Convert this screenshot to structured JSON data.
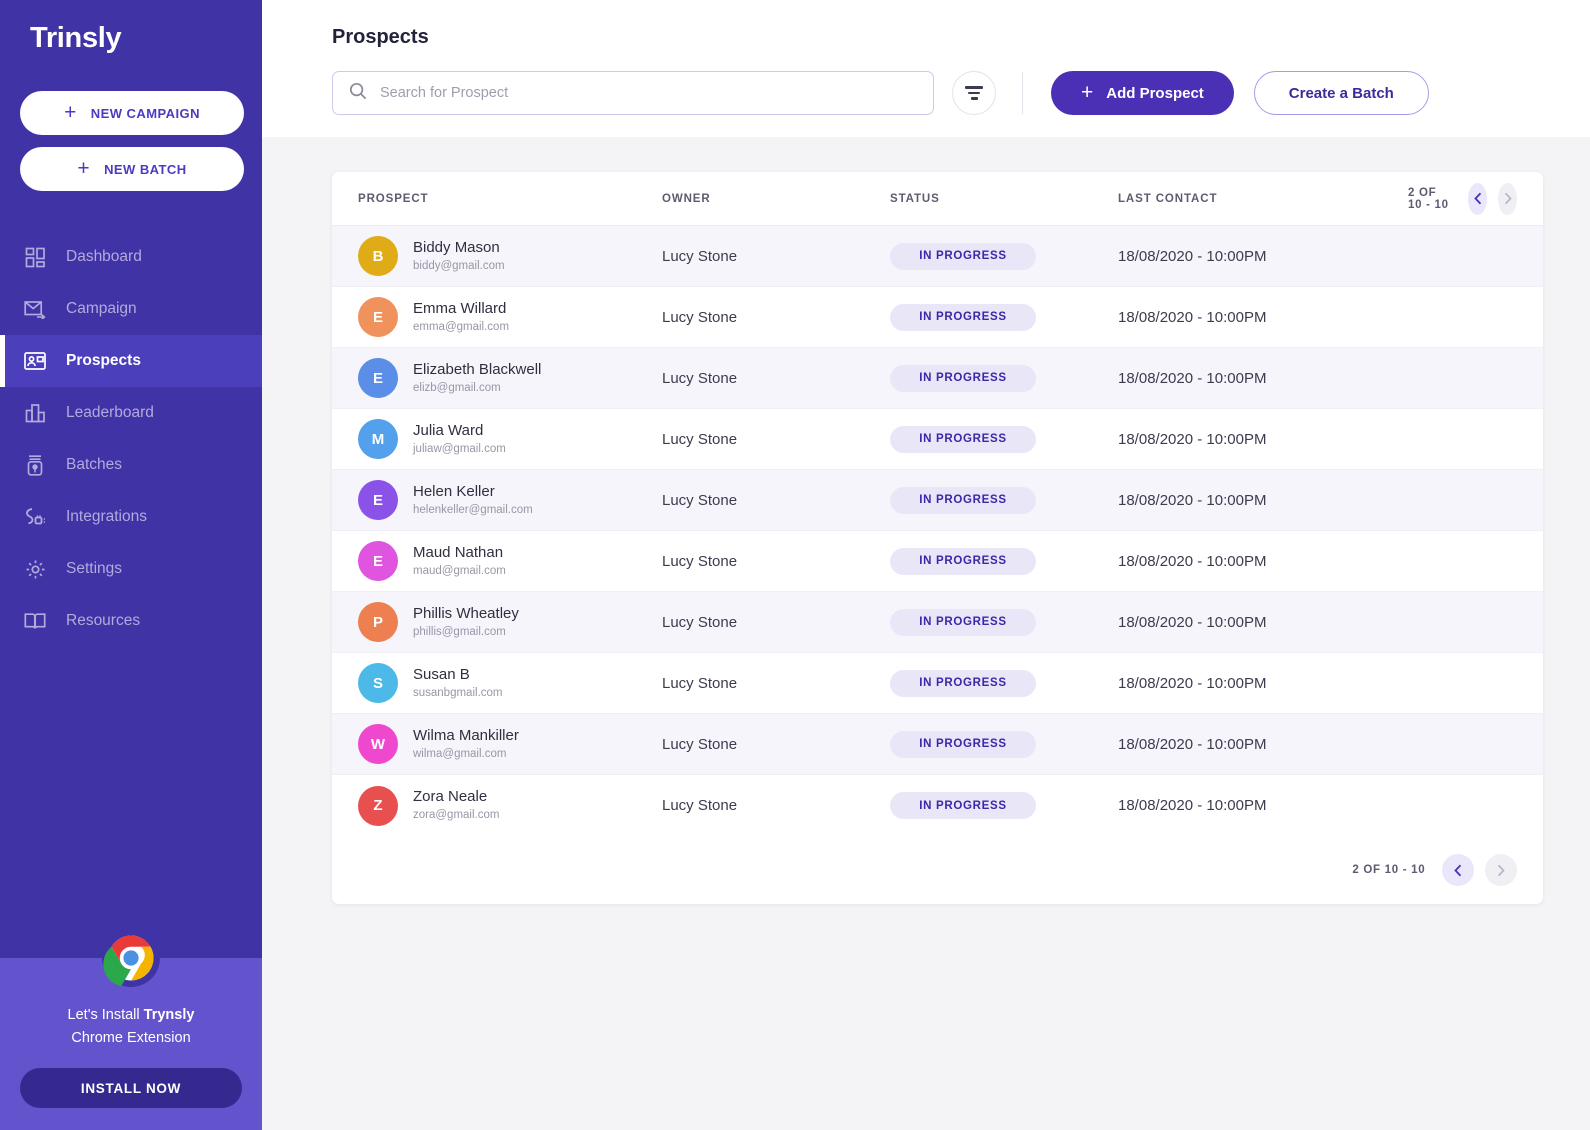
{
  "brand": {
    "logo": "Trinsly"
  },
  "sidebar": {
    "actions": [
      {
        "label": "NEW CAMPAIGN",
        "icon": "plus-icon"
      },
      {
        "label": "NEW BATCH",
        "icon": "plus-icon"
      }
    ],
    "items": [
      {
        "label": "Dashboard",
        "icon": "dashboard-icon",
        "active": false
      },
      {
        "label": "Campaign",
        "icon": "envelope-icon",
        "active": false
      },
      {
        "label": "Prospects",
        "icon": "contact-card-icon",
        "active": true
      },
      {
        "label": "Leaderboard",
        "icon": "bar-chart-icon",
        "active": false
      },
      {
        "label": "Batches",
        "icon": "jar-icon",
        "active": false
      },
      {
        "label": "Integrations",
        "icon": "plug-icon",
        "active": false
      },
      {
        "label": "Settings",
        "icon": "gear-icon",
        "active": false
      },
      {
        "label": "Resources",
        "icon": "book-icon",
        "active": false
      }
    ],
    "promo": {
      "icon": "chrome-icon",
      "line1_prefix": "Let's Install ",
      "line1_bold": "Trynsly",
      "line2": "Chrome Extension",
      "button": "INSTALL NOW"
    }
  },
  "header": {
    "title": "Prospects",
    "search_placeholder": "Search for Prospect",
    "search_value": "",
    "filter_icon": "filter-icon",
    "add_prospect": "Add Prospect",
    "create_batch": "Create a Batch"
  },
  "table": {
    "columns": {
      "prospect": "PROSPECT",
      "owner": "OWNER",
      "status": "STATUS",
      "last_contact": "LAST CONTACT"
    },
    "pagination": {
      "label": "2 OF 10 - 10",
      "prev_icon": "chevron-left-icon",
      "next_icon": "chevron-right-icon"
    },
    "rows": [
      {
        "initial": "B",
        "color": "#dfab17",
        "name": "Biddy Mason",
        "email": "biddy@gmail.com",
        "owner": "Lucy Stone",
        "status": "IN PROGRESS",
        "last_contact": "18/08/2020 - 10:00PM"
      },
      {
        "initial": "E",
        "color": "#f0925c",
        "name": "Emma Willard",
        "email": "emma@gmail.com",
        "owner": "Lucy Stone",
        "status": "IN PROGRESS",
        "last_contact": "18/08/2020 - 10:00PM"
      },
      {
        "initial": "E",
        "color": "#5b8ee6",
        "name": "Elizabeth Blackwell",
        "email": "elizb@gmail.com",
        "owner": "Lucy Stone",
        "status": "IN PROGRESS",
        "last_contact": "18/08/2020 - 10:00PM"
      },
      {
        "initial": "M",
        "color": "#53a0ec",
        "name": "Julia Ward",
        "email": "juliaw@gmail.com",
        "owner": "Lucy Stone",
        "status": "IN PROGRESS",
        "last_contact": "18/08/2020 - 10:00PM"
      },
      {
        "initial": "E",
        "color": "#8b52e8",
        "name": "Helen Keller",
        "email": "helenkeller@gmail.com",
        "owner": "Lucy Stone",
        "status": "IN PROGRESS",
        "last_contact": "18/08/2020 - 10:00PM"
      },
      {
        "initial": "E",
        "color": "#e055e0",
        "name": "Maud Nathan",
        "email": "maud@gmail.com",
        "owner": "Lucy Stone",
        "status": "IN PROGRESS",
        "last_contact": "18/08/2020 - 10:00PM"
      },
      {
        "initial": "P",
        "color": "#ed7f50",
        "name": "Phillis Wheatley",
        "email": "phillis@gmail.com",
        "owner": "Lucy Stone",
        "status": "IN PROGRESS",
        "last_contact": "18/08/2020 - 10:00PM"
      },
      {
        "initial": "S",
        "color": "#4cb9e8",
        "name": "Susan B",
        "email": "susanbgmail.com",
        "owner": "Lucy Stone",
        "status": "IN PROGRESS",
        "last_contact": "18/08/2020 - 10:00PM"
      },
      {
        "initial": "W",
        "color": "#ef48cf",
        "name": "Wilma Mankiller",
        "email": "wilma@gmail.com",
        "owner": "Lucy Stone",
        "status": "IN PROGRESS",
        "last_contact": "18/08/2020 - 10:00PM"
      },
      {
        "initial": "Z",
        "color": "#e8504f",
        "name": "Zora Neale",
        "email": "zora@gmail.com",
        "owner": "Lucy Stone",
        "status": "IN PROGRESS",
        "last_contact": "18/08/2020 - 10:00PM"
      }
    ]
  },
  "colors": {
    "sidebar": "#3f33a6",
    "sidebar_active": "#4c3fbb",
    "promo": "#6353cc",
    "primary": "#4b2fb5",
    "badge_bg": "#e9e6f8",
    "badge_text": "#3a28a8"
  }
}
